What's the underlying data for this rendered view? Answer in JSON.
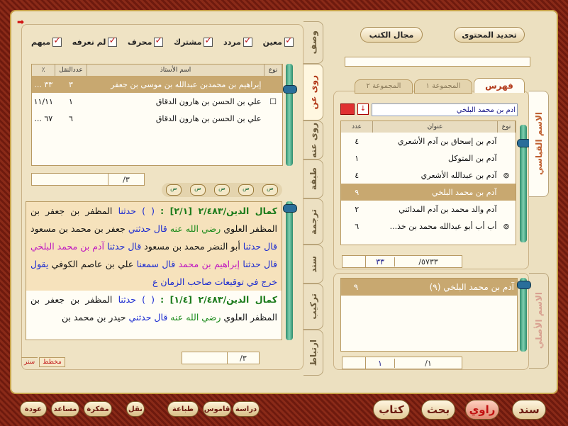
{
  "filters": [
    "معين",
    "مردد",
    "مشترك",
    "محرف",
    "لم نعرفه",
    "مبهم"
  ],
  "left_table": {
    "headers": {
      "type": "نوع",
      "name": "اسم الأستاذ",
      "count": "عددالنقل",
      "pct": "٪"
    },
    "rows": [
      {
        "type": "",
        "name": "إبراهيم بن محمدبن عبدالله بن موسى بن جعفر",
        "count": "٣",
        "pct": "٣٣ ..."
      },
      {
        "type": "☐",
        "name": "علي بن الحسن بن هارون الدقاق",
        "count": "١",
        "pct": "١١/١١"
      },
      {
        "type": "",
        "name": "علي بن الحسن بن هارون الدقاق",
        "count": "٦",
        "pct": "٦٧ ..."
      }
    ],
    "counter": "٣/"
  },
  "mini_buttons": [
    "ص",
    "ص",
    "ص",
    "ص",
    "ص"
  ],
  "text_blocks": [
    {
      "ref": "كمال الدين/٢/٤٨٣ [٢/١] :",
      "pre": " ( ) حدثنا ",
      "body": "المظفر بن جعفر بن المظفر العلوي",
      "rz": " رضي الله عنه ",
      "q1": "قال حدثني ",
      "body2": "جعفر بن محمد بن مسعود ",
      "q2": "قال حدثنا ",
      "body3": "أبو النضر محمد بن مسعود ",
      "q3": "قال حدثنا ",
      "adam": " آدم بن محمد البلخي ",
      "q4": "قال حدثنا ",
      "ibr": " إبراهيم بن محمد ",
      "q5": "قال سمعنا ",
      "body4": "علي بن عاصم الكوفي ",
      "q6": "يقول خرج في توقيعات صاحب الزمان ع"
    },
    {
      "ref": "كمال الدين/٢/٤٨٣ [١/٤] :",
      "pre": " ( ) حدثنا ",
      "body": "المظفر بن جعفر بن المظفر العلوي",
      "rz": " رضي الله عنه ",
      "q1": "قال حدثني ",
      "body2": "حيدر بن محمد بن"
    }
  ],
  "text_counter": "٣/",
  "text_tabs": [
    "مخطط",
    "سنر"
  ],
  "vtabs": [
    "وصف",
    "روى عن",
    "روى عنه",
    "طبقة",
    "ترجمة",
    "سند",
    "تركيب",
    "ارتباط"
  ],
  "top_buttons": {
    "update": "تحديد المحتوى",
    "book": "مجال الكتب"
  },
  "right_tabs": [
    "فهرس",
    "المجموعة ١",
    "المجموعة ٢"
  ],
  "right_search": "آدم بن محمد البلخي",
  "right_table": {
    "headers": {
      "type": "نوع",
      "title": "عنوان",
      "count": "عدد"
    },
    "rows": [
      {
        "type": "",
        "title": "آدم بن إسحاق بن آدم الأشعري",
        "count": "٤"
      },
      {
        "type": "",
        "title": "آدم بن المتوكل",
        "count": "١"
      },
      {
        "type": "⊚",
        "title": "آدم بن عبدالله الأشعري",
        "count": "٤"
      },
      {
        "type": "",
        "title": "آدم بن محمد البلخي",
        "count": "٩"
      },
      {
        "type": "",
        "title": "آدم والد محمد بن آدم المدائني",
        "count": "٢"
      },
      {
        "type": "⊚",
        "title": "أب أب أبو عبدالله محمد بن خذ...",
        "count": "٦"
      }
    ],
    "counter_total": "٥٧٣٣/",
    "counter_val": "٣٣"
  },
  "right_vtabs": [
    "الاسم القياسي",
    "الاسم الأصلي"
  ],
  "bottom_list": {
    "row": "آدم بن محمد البلخي (٩)",
    "count": "٩",
    "counter_total": "١/",
    "counter_val": "١"
  },
  "bottom_buttons": [
    "دراسة",
    "قاموس",
    "طباعة",
    "نقل",
    "مفكرة",
    "مساعد",
    "عودة"
  ],
  "big_buttons": [
    "سند",
    "راوي",
    "بحث",
    "كتاب"
  ]
}
